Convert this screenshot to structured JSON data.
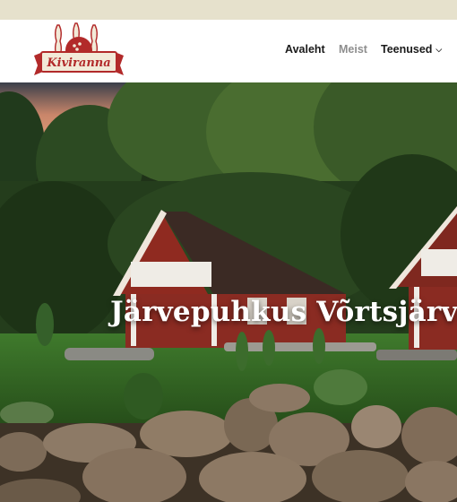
{
  "brand": {
    "logo_text": "Kiviranna",
    "logo_colors": {
      "red": "#b22a2a",
      "cream": "#f2ead8"
    }
  },
  "nav": {
    "items": [
      {
        "label": "Avaleht",
        "active": false
      },
      {
        "label": "Meist",
        "active": true
      },
      {
        "label": "Teenused",
        "active": false,
        "has_dropdown": true
      }
    ],
    "dropdown_icon": "chevron-down-icon"
  },
  "hero": {
    "title": "Järvepuhkus Võrtsjärve",
    "title_color": "#ffffff"
  },
  "colors": {
    "topbar": "#e6e1cc",
    "header": "#ffffff",
    "nav_text": "#1a1a1a",
    "nav_active": "#8e8e8e"
  }
}
